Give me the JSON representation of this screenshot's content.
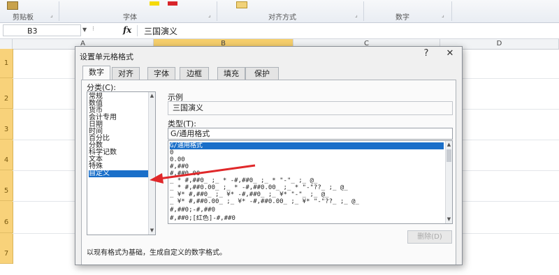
{
  "ribbon": {
    "groups": [
      {
        "label": "剪贴板"
      },
      {
        "label": "字体"
      },
      {
        "label": "对齐方式"
      },
      {
        "label": "数字"
      }
    ]
  },
  "formula_bar": {
    "name_box": "B3",
    "fx_icon": "fx",
    "value": "三国演义"
  },
  "columns": [
    "A",
    "B",
    "C",
    "D"
  ],
  "rows": [
    "1",
    "2",
    "3",
    "4",
    "5",
    "6",
    "7"
  ],
  "dialog": {
    "title": "设置单元格格式",
    "help": "?",
    "close": "✕",
    "tabs": [
      {
        "label": "数字",
        "active": true
      },
      {
        "label": "对齐",
        "active": false
      },
      {
        "label": "字体",
        "active": false
      },
      {
        "label": "边框",
        "active": false
      },
      {
        "label": "填充",
        "active": false
      },
      {
        "label": "保护",
        "active": false
      }
    ],
    "category_label": "分类(C):",
    "categories": [
      "常规",
      "数值",
      "货币",
      "会计专用",
      "日期",
      "时间",
      "百分比",
      "分数",
      "科学记数",
      "文本",
      "特殊",
      "自定义"
    ],
    "selected_category": "自定义",
    "sample_label": "示例",
    "sample_value": "三国演义",
    "type_label": "类型(T):",
    "type_value": "G/通用格式",
    "formats": [
      "G/通用格式",
      "0",
      "0.00",
      "#,##0",
      "#,##0.00",
      "_ * #,##0_ ;_ * -#,##0_ ;_ * \"-\"_ ;_ @_",
      "_ * #,##0.00_ ;_ * -#,##0.00_ ;_ * \"-\"??_ ;_ @_",
      "_ ¥* #,##0_ ;_ ¥* -#,##0_ ;_ ¥* \"-\"_ ;_ @_",
      "_ ¥* #,##0.00_ ;_ ¥* -#,##0.00_ ;_ ¥* \"-\"??_ ;_ @_",
      "#,##0;-#,##0",
      "#,##0;[红色]-#,##0"
    ],
    "selected_format": "G/通用格式",
    "delete_button": "删除(D)",
    "description": "以现有格式为基础，生成自定义的数字格式。"
  },
  "colors": {
    "accent": "#1a6fc9",
    "arrow": "#e0282a",
    "row_header_highlight": "#f8d27a",
    "column_header_highlight": "#f6cf6c"
  }
}
